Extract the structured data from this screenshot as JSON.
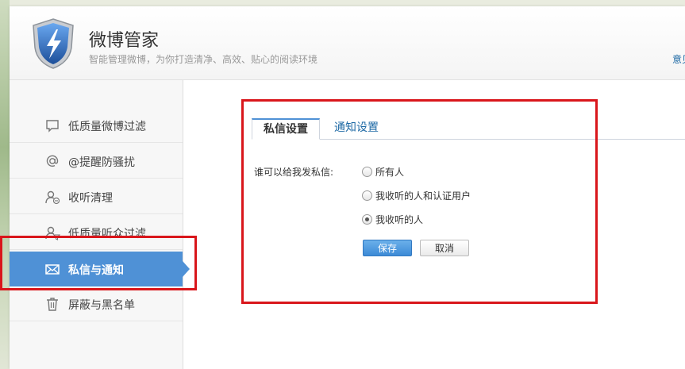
{
  "header": {
    "title": "微博管家",
    "subtitle": "智能管理微博，为你打造清净、高效、贴心的阅读环境",
    "link_partial": "意见"
  },
  "sidebar": {
    "items": [
      {
        "label": "低质量微博过滤",
        "icon": "comment-icon"
      },
      {
        "label": "@提醒防骚扰",
        "icon": "at-icon"
      },
      {
        "label": "收听清理",
        "icon": "user-minus-icon"
      },
      {
        "label": "低质量听众过滤",
        "icon": "user-filter-icon"
      },
      {
        "label": "私信与通知",
        "icon": "envelope-icon",
        "active": true
      },
      {
        "label": "屏蔽与黑名单",
        "icon": "trash-icon"
      }
    ]
  },
  "tabs": [
    {
      "label": "私信设置",
      "active": true
    },
    {
      "label": "通知设置",
      "active": false
    }
  ],
  "form": {
    "label": "谁可以给我发私信:",
    "options": [
      {
        "label": "所有人",
        "checked": false
      },
      {
        "label": "我收听的人和认证用户",
        "checked": false
      },
      {
        "label": "我收听的人",
        "checked": true
      }
    ],
    "save_label": "保存",
    "cancel_label": "取消"
  },
  "colors": {
    "accent": "#4f91d6",
    "highlight": "#d9161b",
    "link": "#1f6aa5"
  }
}
